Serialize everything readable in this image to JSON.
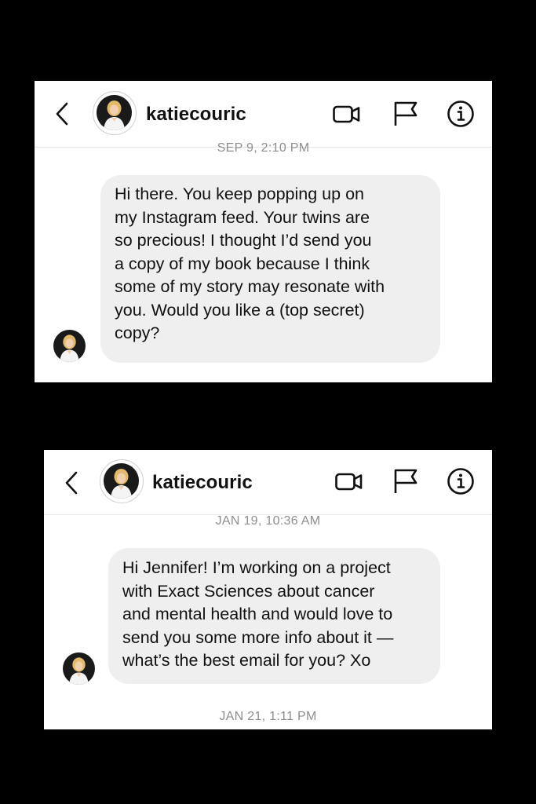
{
  "screens": [
    {
      "header": {
        "username": "katiecouric",
        "icons": [
          "back-chevron-icon",
          "video-call-icon",
          "flag-icon",
          "info-icon"
        ]
      },
      "timestamp_top": "SEP 9, 2:10 PM",
      "message": {
        "text": "Hi there. You keep popping up on\nmy Instagram feed. Your twins are\nso precious!  I thought I’d send you\na copy of my book because I think\nsome of my story may resonate with\nyou. Would you like a (top secret)\ncopy?"
      }
    },
    {
      "header": {
        "username": "katiecouric",
        "icons": [
          "back-chevron-icon",
          "video-call-icon",
          "flag-icon",
          "info-icon"
        ]
      },
      "timestamp_top": "JAN 19, 10:36 AM",
      "message": {
        "text": "Hi Jennifer! I’m working on a project\nwith Exact Sciences about cancer\nand mental health and would love to\nsend you some more info about it —\nwhat’s the best email for you? Xo"
      },
      "timestamp_bottom": "JAN 21, 1:11 PM"
    }
  ],
  "colors": {
    "background": "#000000",
    "panel": "#ffffff",
    "bubble": "#efefef",
    "timestamp": "#8e8e8e",
    "text": "#111111"
  }
}
